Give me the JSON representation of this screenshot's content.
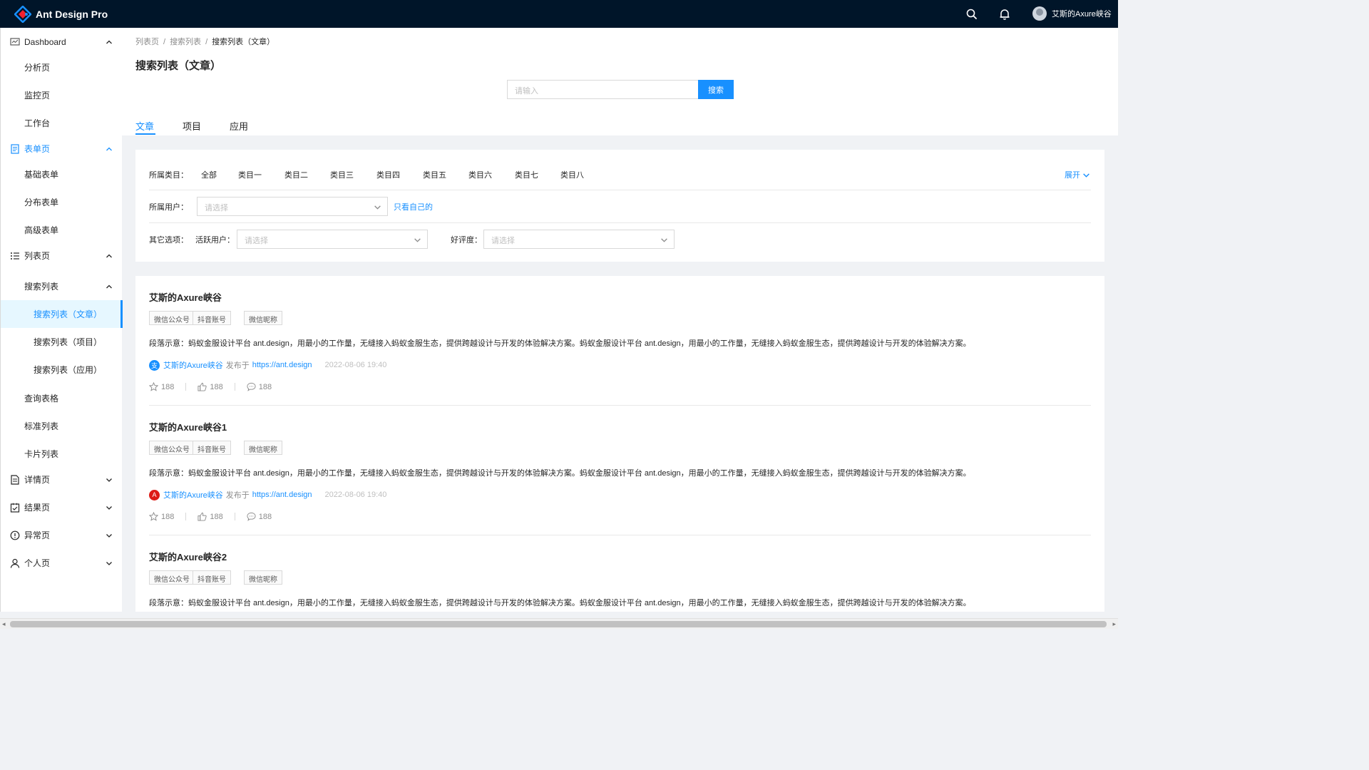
{
  "app": {
    "title": "Ant Design Pro",
    "user": "艾斯的Axure峡谷"
  },
  "colors": {
    "primary": "#1890ff",
    "header_bg": "#001529",
    "avatar_alipay": "#1890ff",
    "avatar_angular": "#dd1b16"
  },
  "icons": {
    "search": "search-icon",
    "bell": "bell-icon"
  },
  "sidebar": {
    "items": [
      {
        "label": "Dashboard",
        "icon": "dashboard-icon",
        "arrow": "up"
      },
      {
        "label": "分析页"
      },
      {
        "label": "监控页"
      },
      {
        "label": "工作台"
      },
      {
        "label": "表单页",
        "icon": "form-icon",
        "arrow": "up"
      },
      {
        "label": "基础表单"
      },
      {
        "label": "分布表单"
      },
      {
        "label": "高级表单"
      },
      {
        "label": "列表页",
        "icon": "list-icon",
        "arrow": "up"
      },
      {
        "label": "搜索列表",
        "arrow": "up"
      },
      {
        "label": "搜索列表（文章）"
      },
      {
        "label": "搜索列表（项目）"
      },
      {
        "label": "搜索列表（应用）"
      },
      {
        "label": "查询表格"
      },
      {
        "label": "标准列表"
      },
      {
        "label": "卡片列表"
      },
      {
        "label": "详情页",
        "icon": "profile-icon",
        "arrow": "down"
      },
      {
        "label": "结果页",
        "icon": "check-square-icon",
        "arrow": "down"
      },
      {
        "label": "异常页",
        "icon": "warning-icon",
        "arrow": "down"
      },
      {
        "label": "个人页",
        "icon": "user-icon",
        "arrow": "down"
      }
    ]
  },
  "breadcrumb": [
    "列表页",
    "搜索列表",
    "搜索列表（文章）"
  ],
  "page": {
    "title": "搜索列表（文章）",
    "search_placeholder": "请输入",
    "search_button": "搜索",
    "tabs": [
      "文章",
      "项目",
      "应用"
    ]
  },
  "filter": {
    "category_label": "所属类目：",
    "categories": [
      "全部",
      "类目一",
      "类目二",
      "类目三",
      "类目四",
      "类目五",
      "类目六",
      "类目七",
      "类目八"
    ],
    "expand": "展开",
    "owner_label": "所属用户：",
    "owner_placeholder": "请选择",
    "owner_link": "只看自己的",
    "other_label": "其它选项：",
    "active_user_label": "活跃用户：",
    "active_user_placeholder": "请选择",
    "rating_label": "好评度：",
    "rating_placeholder": "请选择"
  },
  "articles": [
    {
      "title": "艾斯的Axure峡谷",
      "tags": [
        "微信公众号",
        "抖音账号",
        "微信昵称"
      ],
      "description": "段落示意：蚂蚁金服设计平台 ant.design，用最小的工作量，无缝接入蚂蚁金服生态，提供跨越设计与开发的体验解决方案。蚂蚁金服设计平台 ant.design，用最小的工作量，无缝接入蚂蚁金服生态，提供跨越设计与开发的体验解决方案。",
      "avatar_glyph": "支",
      "author": "艾斯的Axure峡谷",
      "published_at_label": "发布于",
      "link": "https://ant.design",
      "time": "2022-08-06 19:40",
      "stars": "188",
      "likes": "188",
      "comments": "188"
    },
    {
      "title": "艾斯的Axure峡谷1",
      "tags": [
        "微信公众号",
        "抖音账号",
        "微信昵称"
      ],
      "description": "段落示意：蚂蚁金服设计平台 ant.design，用最小的工作量，无缝接入蚂蚁金服生态，提供跨越设计与开发的体验解决方案。蚂蚁金服设计平台 ant.design，用最小的工作量，无缝接入蚂蚁金服生态，提供跨越设计与开发的体验解决方案。",
      "avatar_glyph": "A",
      "author": "艾斯的Axure峡谷",
      "published_at_label": "发布于",
      "link": "https://ant.design",
      "time": "2022-08-06 19:40",
      "stars": "188",
      "likes": "188",
      "comments": "188"
    },
    {
      "title": "艾斯的Axure峡谷2",
      "tags": [
        "微信公众号",
        "抖音账号",
        "微信昵称"
      ],
      "description": "段落示意：蚂蚁金服设计平台 ant.design，用最小的工作量，无缝接入蚂蚁金服生态，提供跨越设计与开发的体验解决方案。蚂蚁金服设计平台 ant.design，用最小的工作量，无缝接入蚂蚁金服生态，提供跨越设计与开发的体验解决方案。"
    }
  ]
}
